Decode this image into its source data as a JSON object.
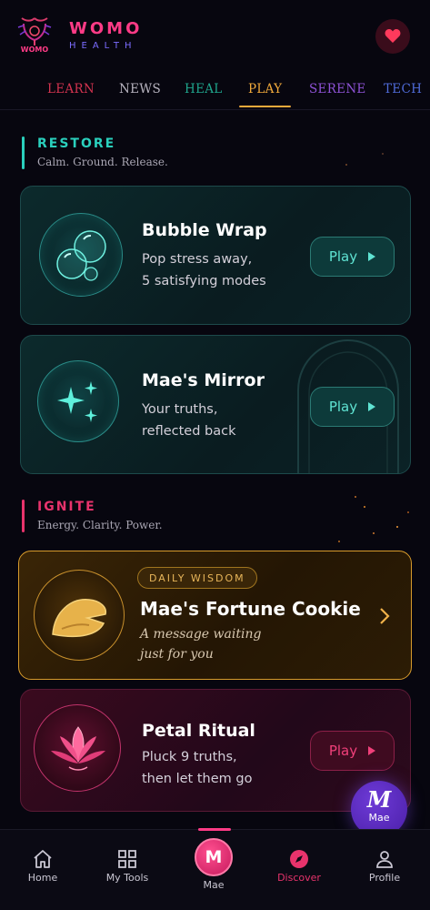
{
  "brand": {
    "name": "WOMO",
    "tagline": "HEALTH",
    "logo_text": "WOMO"
  },
  "header": {
    "favorite_icon": "heart-icon"
  },
  "tabs": [
    {
      "label": "LEARN",
      "color": "#d2334f"
    },
    {
      "label": "NEWS",
      "color": "#b7b3bf"
    },
    {
      "label": "HEAL",
      "color": "#1fa58c"
    },
    {
      "label": "PLAY",
      "color": "#f0a93b",
      "active": true
    },
    {
      "label": "SERENE",
      "color": "#8e52d6"
    },
    {
      "label": "TECH",
      "color": "#4f6bd8"
    }
  ],
  "restore": {
    "title": "RESTORE",
    "subtitle": "Calm. Ground. Release.",
    "accent": "#2ad0bd",
    "cards": [
      {
        "title": "Bubble Wrap",
        "desc_line1": "Pop stress away,",
        "desc_line2": "5 satisfying modes",
        "button": "Play",
        "icon": "bubbles-icon"
      },
      {
        "title": "Mae's Mirror",
        "desc_line1": "Your truths,",
        "desc_line2": "reflected back",
        "button": "Play",
        "icon": "sparkles-icon"
      }
    ]
  },
  "ignite": {
    "title": "IGNITE",
    "subtitle": "Energy. Clarity. Power.",
    "accent": "#e8336c",
    "fortune": {
      "badge": "DAILY WISDOM",
      "title": "Mae's Fortune Cookie",
      "desc_line1": "A message waiting",
      "desc_line2": "just for you",
      "icon": "fortune-cookie-icon"
    },
    "petal": {
      "title": "Petal Ritual",
      "desc_line1": "Pluck 9 truths,",
      "desc_line2": "then let them go",
      "button": "Play",
      "icon": "lotus-icon"
    }
  },
  "fab": {
    "letter": "M",
    "label": "Mae"
  },
  "nav": {
    "home": "Home",
    "tools": "My Tools",
    "mae_letter": "M",
    "mae": "Mae",
    "discover": "Discover",
    "profile": "Profile"
  }
}
